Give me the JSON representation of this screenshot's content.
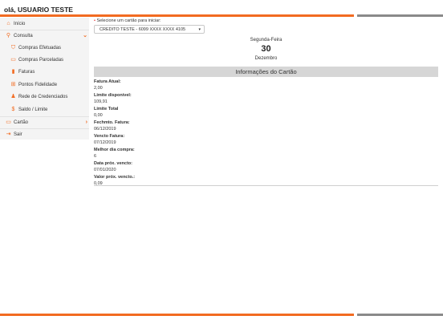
{
  "header": {
    "greeting": "olá, USUARIO TESTE"
  },
  "sidebar": {
    "items": [
      {
        "label": "Início",
        "icon": "home-icon"
      },
      {
        "label": "Consulta",
        "icon": "search-icon"
      },
      {
        "label": "Compras Efetuadas",
        "icon": "basket-icon"
      },
      {
        "label": "Compras Parceladas",
        "icon": "credit-card-icon"
      },
      {
        "label": "Faturas",
        "icon": "document-icon"
      },
      {
        "label": "Pontos Fidelidade",
        "icon": "gift-icon"
      },
      {
        "label": "Rede de Credenciados",
        "icon": "users-icon"
      },
      {
        "label": "Saldo / Limite",
        "icon": "dollar-icon"
      },
      {
        "label": "Cartão",
        "icon": "credit-card-icon"
      },
      {
        "label": "Sair",
        "icon": "logout-icon"
      }
    ]
  },
  "card_select": {
    "label": "Selecione um cartão para iniciar:",
    "value": "CREDITO TESTE - 6099 XXXX XXXX 4105"
  },
  "date": {
    "weekday": "Segunda-Feira",
    "day": "30",
    "month": "Dezembro"
  },
  "info": {
    "title": "Informações do Cartão",
    "rows": [
      {
        "label": "Fatura Atual:",
        "value": "2,00"
      },
      {
        "label": "Limite disponível:",
        "value": "109,91"
      },
      {
        "label": "Limite Total",
        "value": "0,00"
      },
      {
        "label": "Fechmto. Fatura:",
        "value": "06/12/2019"
      },
      {
        "label": "Vencto Fatura:",
        "value": "07/12/2019"
      },
      {
        "label": "Melhor dia compra:",
        "value": "6"
      },
      {
        "label": "Data próx. vencto:",
        "value": "07/01/2020"
      },
      {
        "label": "Valor próx. vencto.:",
        "value": "0,09"
      }
    ]
  },
  "colors": {
    "accent": "#f26b21",
    "gray_stripe": "#8a8a8a",
    "sidebar_bg": "#f4f4f4",
    "header_bg": "#d6d6d6"
  }
}
